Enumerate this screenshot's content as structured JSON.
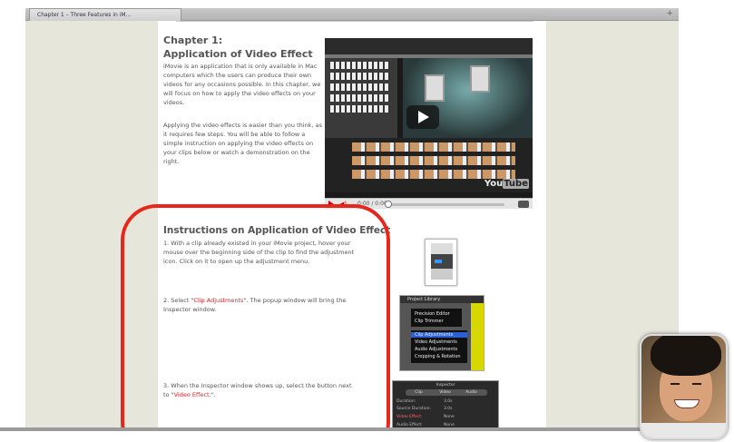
{
  "browser": {
    "tab_title": "Chapter 1 – Three Features in iM...",
    "new_tab_symbol": "+"
  },
  "chapter": {
    "heading_line1": "Chapter 1:",
    "heading_line2": "Application of Video Effect",
    "intro_paragraph": "iMovie is an application that is only available in Mac computers which the users can produce their own videos for any occasions possible. In this chapter, we will focus on how to apply the video effects on your videos.",
    "second_paragraph": "Applying the video effects is easier than you think, as it requires few steps. You will be able to follow a simple instruction on applying the video effects on your clips below or watch a demonstration on the right."
  },
  "video": {
    "time": "0:00 / 0:00",
    "youtube_logo_you": "You",
    "youtube_logo_tube": "Tube"
  },
  "instructions": {
    "heading": "Instructions on Application of Video Effect",
    "step1": "1. With a clip already existed in your iMovie project, hover your mouse over the beginning side of the clip to find the adjustment icon. Click on it to open up the adjustment menu.",
    "step2_prefix": "2. Select \"",
    "step2_highlight": "Clip Adjustments",
    "step2_suffix": "\". The popup window will bring the Inspector window.",
    "step3_prefix": "3. When the Inspector window shows up, select the button next to \"",
    "step3_highlight": "Video Effect:",
    "step3_suffix": "\"."
  },
  "menu_image": {
    "header": "Project Library",
    "items_top": [
      "Precision Editor",
      "Clip Trimmer"
    ],
    "items_bottom": [
      "Clip Adjustments",
      "Video Adjustments",
      "Audio Adjustments",
      "Cropping & Rotation"
    ],
    "selected": "Clip Adjustments"
  },
  "inspector_image": {
    "title": "Inspector",
    "tabs": [
      "Clip",
      "Video",
      "Audio"
    ],
    "rows": [
      "Duration:",
      "Source Duration:",
      "Video Effect:",
      "Audio Effect:"
    ],
    "values": [
      "3.0s",
      "3.0s",
      "None",
      "None"
    ]
  },
  "colors": {
    "accent_red": "#e02020",
    "annotation_red": "#e8271c",
    "page_bg": "#e7e6db"
  }
}
